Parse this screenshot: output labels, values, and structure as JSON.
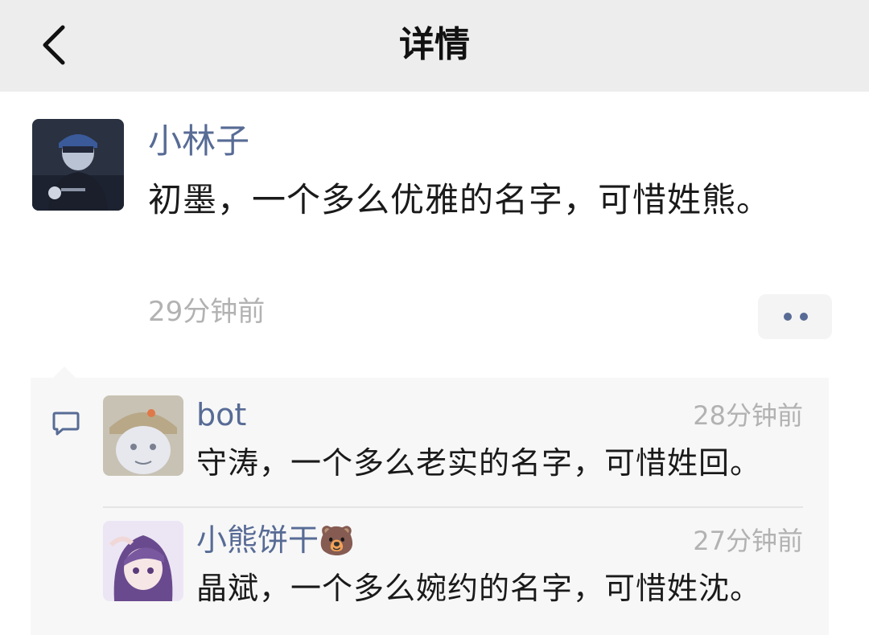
{
  "nav": {
    "title": "详情"
  },
  "post": {
    "author": "小林子",
    "content": "初墨，一个多么优雅的名字，可惜姓熊。",
    "time": "29分钟前"
  },
  "comments": [
    {
      "author": "bot",
      "time": "28分钟前",
      "text": "守涛，一个多么老实的名字，可惜姓回。"
    },
    {
      "author": "小熊饼干",
      "author_emoji": "🐻",
      "time": "27分钟前",
      "text": "晶斌，一个多么婉约的名字，可惜姓沈。"
    }
  ],
  "colors": {
    "name_link": "#576b95",
    "time_gray": "#b2b2b2",
    "nav_bg": "#ededed",
    "comment_bg": "#f7f7f7"
  },
  "icons": [
    "back-arrow-icon",
    "more-dots-icon",
    "comment-bubble-icon"
  ]
}
